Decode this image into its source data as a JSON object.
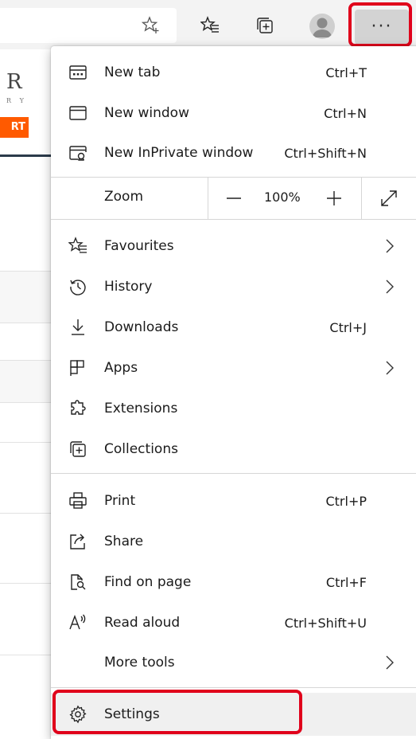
{
  "toolbar": {
    "icons": [
      "add-favorite-icon",
      "favorites-icon",
      "collections-icon",
      "profile-icon",
      "more-icon"
    ],
    "more_label": "···"
  },
  "page": {
    "logo_letter": "R",
    "logo_sub": "R Y",
    "orange_button": "RT"
  },
  "menu": {
    "new_tab": {
      "label": "New tab",
      "shortcut": "Ctrl+T"
    },
    "new_window": {
      "label": "New window",
      "shortcut": "Ctrl+N"
    },
    "new_inprivate": {
      "label": "New InPrivate window",
      "shortcut": "Ctrl+Shift+N"
    },
    "zoom": {
      "label": "Zoom",
      "value": "100%"
    },
    "favourites": {
      "label": "Favourites"
    },
    "history": {
      "label": "History"
    },
    "downloads": {
      "label": "Downloads",
      "shortcut": "Ctrl+J"
    },
    "apps": {
      "label": "Apps"
    },
    "extensions": {
      "label": "Extensions"
    },
    "collections": {
      "label": "Collections"
    },
    "print": {
      "label": "Print",
      "shortcut": "Ctrl+P"
    },
    "share": {
      "label": "Share"
    },
    "find_on_page": {
      "label": "Find on page",
      "shortcut": "Ctrl+F"
    },
    "read_aloud": {
      "label": "Read aloud",
      "shortcut": "Ctrl+Shift+U"
    },
    "more_tools": {
      "label": "More tools"
    },
    "settings": {
      "label": "Settings"
    }
  },
  "colors": {
    "highlight": "#e0001b",
    "accent_orange": "#ff5a00"
  }
}
